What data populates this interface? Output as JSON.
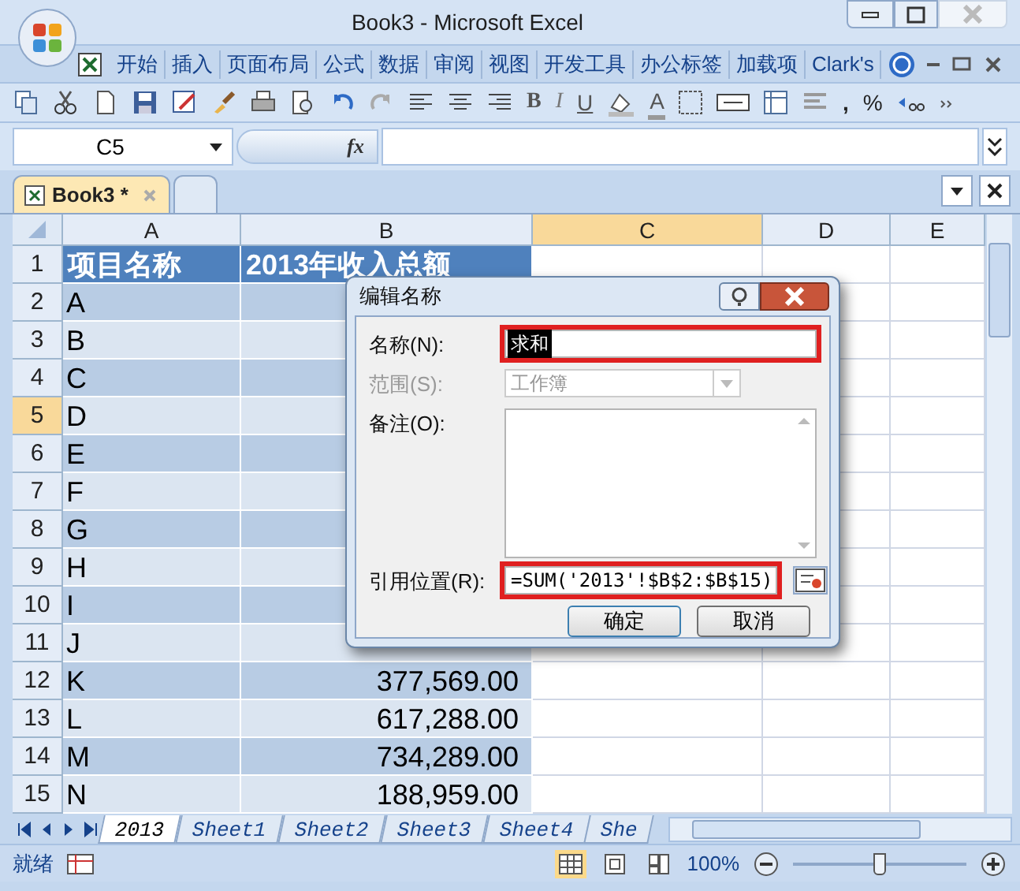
{
  "window": {
    "title": "Book3 - Microsoft Excel"
  },
  "ribbon_tabs": [
    "开始",
    "插入",
    "页面布局",
    "公式",
    "数据",
    "审阅",
    "视图",
    "开发工具",
    "办公标签",
    "加载项",
    "Clark's"
  ],
  "toolbar_glyphs": [
    "B",
    "I",
    "U",
    "A",
    ",",
    "%"
  ],
  "formula_bar": {
    "name_box": "C5",
    "fx": "fx"
  },
  "workbook_tabs": [
    {
      "label": "Book3 *",
      "selected": true
    }
  ],
  "columns": [
    {
      "label": "A",
      "selected": false
    },
    {
      "label": "B",
      "selected": false
    },
    {
      "label": "C",
      "selected": true
    },
    {
      "label": "D",
      "selected": false
    },
    {
      "label": "E",
      "selected": false
    }
  ],
  "rows": [
    {
      "number": "1",
      "kind": "header",
      "selected": false,
      "cells": [
        "项目名称",
        "2013年收入总额"
      ]
    },
    {
      "number": "2",
      "kind": "data",
      "selected": false,
      "cells": [
        "A"
      ]
    },
    {
      "number": "3",
      "kind": "data",
      "selected": false,
      "cells": [
        "B"
      ]
    },
    {
      "number": "4",
      "kind": "data",
      "selected": false,
      "cells": [
        "C"
      ]
    },
    {
      "number": "5",
      "kind": "data",
      "selected": true,
      "cells": [
        "D"
      ]
    },
    {
      "number": "6",
      "kind": "data",
      "selected": false,
      "cells": [
        "E"
      ]
    },
    {
      "number": "7",
      "kind": "data",
      "selected": false,
      "cells": [
        "F"
      ]
    },
    {
      "number": "8",
      "kind": "data",
      "selected": false,
      "cells": [
        "G"
      ]
    },
    {
      "number": "9",
      "kind": "data",
      "selected": false,
      "cells": [
        "H"
      ]
    },
    {
      "number": "10",
      "kind": "data",
      "selected": false,
      "cells": [
        "I"
      ]
    },
    {
      "number": "11",
      "kind": "data",
      "selected": false,
      "cells": [
        "J"
      ]
    },
    {
      "number": "12",
      "kind": "data",
      "selected": false,
      "cells": [
        "K",
        "377,569.00"
      ]
    },
    {
      "number": "13",
      "kind": "data",
      "selected": false,
      "cells": [
        "L",
        "617,288.00"
      ]
    },
    {
      "number": "14",
      "kind": "data",
      "selected": false,
      "cells": [
        "M",
        "734,289.00"
      ]
    },
    {
      "number": "15",
      "kind": "data",
      "selected": false,
      "cells": [
        "N",
        "188,959.00"
      ]
    }
  ],
  "sheet_tabs": [
    {
      "label": "2013",
      "selected": true
    },
    {
      "label": "Sheet1",
      "selected": false
    },
    {
      "label": "Sheet2",
      "selected": false
    },
    {
      "label": "Sheet3",
      "selected": false
    },
    {
      "label": "Sheet4",
      "selected": false
    },
    {
      "label": "She",
      "selected": false
    }
  ],
  "status_bar": {
    "status": "就绪",
    "zoom": "100%",
    "zoom_level": {
      "level": 0.5
    }
  },
  "dialog": {
    "title": "编辑名称",
    "fields": [
      {
        "kind": "text",
        "label": "名称(N):",
        "value": "求和",
        "text_selected": true,
        "highlighted": true,
        "disabled": false
      },
      {
        "kind": "dropdown",
        "label": "范围(S):",
        "value": "工作簿",
        "text_selected": false,
        "highlighted": false,
        "disabled": true
      },
      {
        "kind": "textarea",
        "label": "备注(O):",
        "highlighted": false,
        "disabled": false
      },
      {
        "kind": "reference",
        "label": "引用位置(R):",
        "value": "=SUM('2013'!$B$2:$B$15)",
        "text_selected": false,
        "highlighted": true,
        "disabled": false
      }
    ],
    "buttons": [
      "确定",
      "取消"
    ]
  }
}
